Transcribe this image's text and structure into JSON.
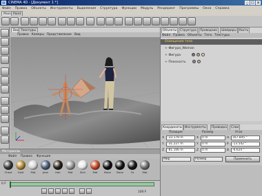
{
  "window": {
    "title": "CINEMA 4D - [Документ 1 *]",
    "buttons": [
      "_",
      "□",
      "x"
    ]
  },
  "menu": [
    "Файл",
    "Правка",
    "Объекты",
    "Инструменты",
    "Выделения",
    "Структура",
    "Функции",
    "Модуль",
    "Рендеринг",
    "Программы",
    "Окно",
    "Справка"
  ],
  "layout_tabs": [
    "Main",
    "Paint"
  ],
  "viewport": {
    "tabs": [
      "Вид",
      "Текстуры"
    ],
    "menu": [
      "Правка",
      "Камеры",
      "Представление",
      "Вид"
    ]
  },
  "right_panel": {
    "tabs": [
      "Объекты",
      "Структура",
      "Проводник",
      "Шейдеры",
      "Кисть"
    ],
    "menu": [
      "Файл",
      "Правка",
      "Объекты",
      "Теги",
      "Текстуры"
    ],
    "objects": [
      {
        "name": "Освещение тело",
        "selected": true,
        "tags": []
      },
      {
        "name": "Фигура_Woman",
        "selected": false,
        "tags": []
      },
      {
        "name": "Фигура",
        "selected": false,
        "tags": [
          "#7a7a7a",
          "#c7a77a",
          "#d9d9d9"
        ]
      },
      {
        "name": "Плоскость",
        "selected": false,
        "tags": [
          "#8a8a8a",
          "#b0b0b0"
        ]
      }
    ]
  },
  "coords": {
    "tabs": [
      "Координаты",
      "Инструменты",
      "Проводка",
      "Слои"
    ],
    "headers": [
      "Позиция",
      "Размер",
      "Угол"
    ],
    "rows": [
      {
        "axis": "X",
        "pos": "-33.179 m",
        "size": "0 m",
        "size_axis": "H",
        "angle": "167.845 °"
      },
      {
        "axis": "Y",
        "pos": "-31.227 m",
        "size": "0 m",
        "size_axis": "P",
        "angle": "-13.542 °"
      },
      {
        "axis": "Z",
        "pos": "-81.106 m",
        "size": "0 m",
        "size_axis": "B",
        "angle": "-6.624 °"
      }
    ],
    "mode_left": "Мир",
    "mode_right": "Размер",
    "apply": "Применить"
  },
  "materials": {
    "header": "Материалы",
    "menu": [
      "Файл",
      "Правка",
      "Функция"
    ],
    "items": [
      {
        "label": "Chest",
        "color": "#3a3a3a"
      },
      {
        "label": "Gold",
        "color": "#b08a3a"
      },
      {
        "label": "Mat",
        "color": "#d7d7d7"
      },
      {
        "label": "Jean",
        "color": "#4e5f7a"
      },
      {
        "label": "Hair",
        "color": "#2b2118"
      },
      {
        "label": "Mat",
        "color": "#9a9a9a"
      },
      {
        "label": "Skin",
        "color": "#e8e8e8"
      },
      {
        "label": "Mat",
        "color": "#c44a2a"
      },
      {
        "label": "Bone",
        "color": "#111"
      },
      {
        "label": "Bone",
        "color": "#151515"
      },
      {
        "label": "Fo",
        "color": "#1a1a1a"
      },
      {
        "label": "Mat",
        "color": "#707070"
      }
    ]
  },
  "timeline": {
    "frame": "0 F",
    "end_frame": "100 F"
  }
}
